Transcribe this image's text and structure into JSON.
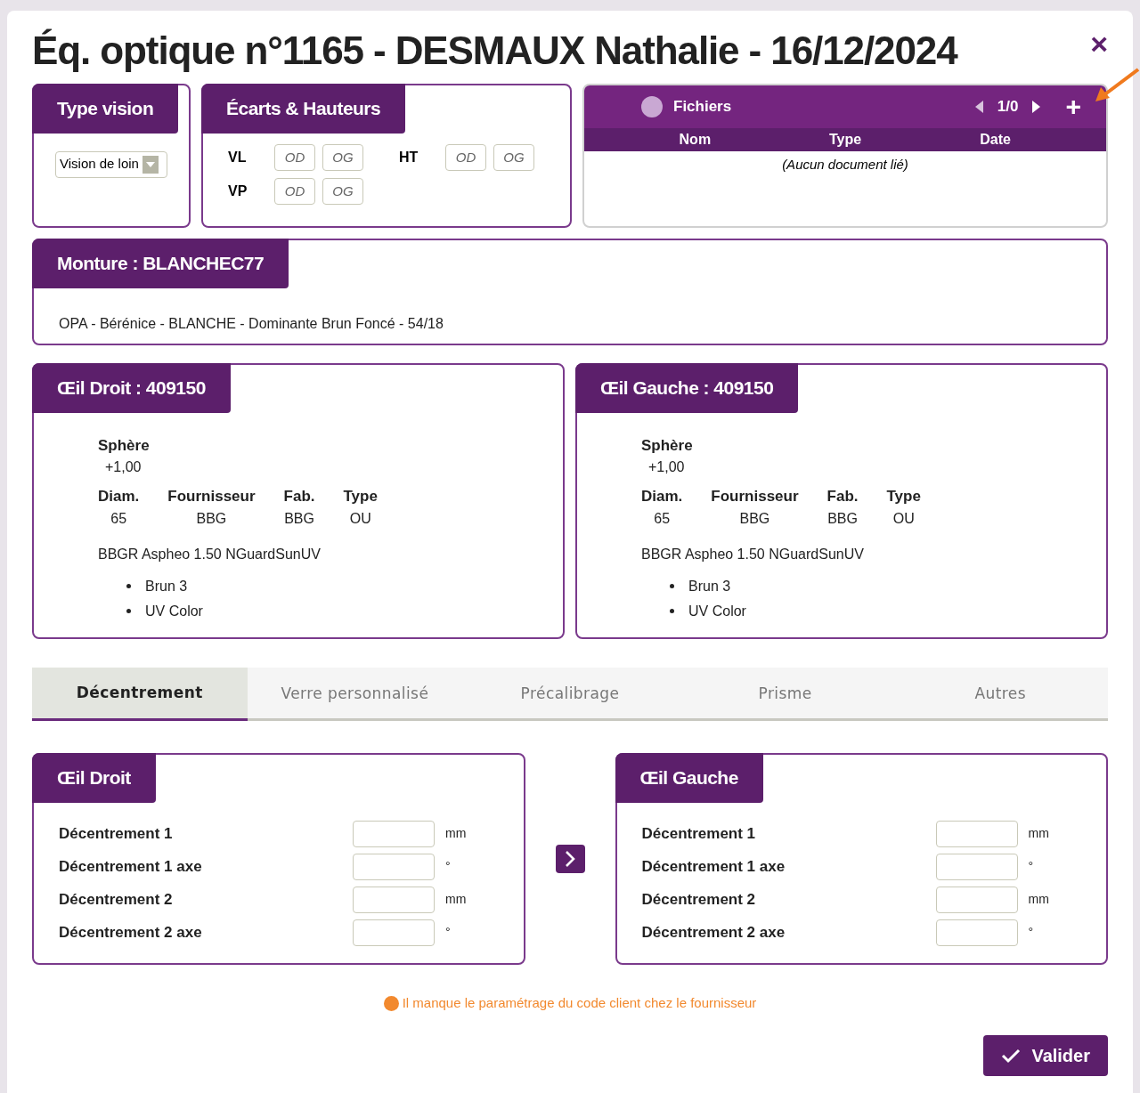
{
  "title": "Éq. optique n°1165 - DESMAUX Nathalie - 16/12/2024",
  "close": "×",
  "type_vision": {
    "title": "Type vision",
    "value": "Vision de loin"
  },
  "ecarts": {
    "title": "Écarts & Hauteurs",
    "rows": [
      {
        "label": "VL",
        "fields": [
          {
            "placeholder": "OD"
          },
          {
            "placeholder": "OG"
          }
        ]
      },
      {
        "label": "VP",
        "fields": [
          {
            "placeholder": "OD"
          },
          {
            "placeholder": "OG"
          }
        ]
      }
    ],
    "ht": {
      "label": "HT",
      "fields": [
        {
          "placeholder": "OD"
        },
        {
          "placeholder": "OG"
        }
      ]
    }
  },
  "fichiers": {
    "title": "Fichiers",
    "pager": "1/0",
    "add": "+",
    "columns": [
      "Nom",
      "Type",
      "Date"
    ],
    "empty": "(Aucun document lié)"
  },
  "monture": {
    "title": "Monture : BLANCHEC77",
    "description": "OPA - Bérénice - BLANCHE - Dominante Brun Foncé - 54/18"
  },
  "eyes": [
    {
      "title": "Œil Droit : 409150",
      "sphere_label": "Sphère",
      "sphere": "+1,00",
      "specs": [
        {
          "label": "Diam.",
          "value": "65"
        },
        {
          "label": "Fournisseur",
          "value": "BBG"
        },
        {
          "label": "Fab.",
          "value": "BBG"
        },
        {
          "label": "Type",
          "value": "OU"
        }
      ],
      "lens": "BBGR Aspheo 1.50 NGuardSunUV",
      "options": [
        "Brun 3",
        "UV Color"
      ]
    },
    {
      "title": "Œil Gauche : 409150",
      "sphere_label": "Sphère",
      "sphere": "+1,00",
      "specs": [
        {
          "label": "Diam.",
          "value": "65"
        },
        {
          "label": "Fournisseur",
          "value": "BBG"
        },
        {
          "label": "Fab.",
          "value": "BBG"
        },
        {
          "label": "Type",
          "value": "OU"
        }
      ],
      "lens": "BBGR Aspheo 1.50 NGuardSunUV",
      "options": [
        "Brun 3",
        "UV Color"
      ]
    }
  ],
  "tabs": [
    {
      "label": "Décentrement",
      "selected": true
    },
    {
      "label": "Verre personnalisé",
      "selected": false
    },
    {
      "label": "Précalibrage",
      "selected": false
    },
    {
      "label": "Prisme",
      "selected": false
    },
    {
      "label": "Autres",
      "selected": false
    }
  ],
  "decentrement": [
    {
      "title": "Œil Droit",
      "rows": [
        {
          "label": "Décentrement 1",
          "unit": "mm"
        },
        {
          "label": "Décentrement 1 axe",
          "unit": "°"
        },
        {
          "label": "Décentrement 2",
          "unit": "mm"
        },
        {
          "label": "Décentrement 2 axe",
          "unit": "°"
        }
      ]
    },
    {
      "title": "Œil Gauche",
      "rows": [
        {
          "label": "Décentrement 1",
          "unit": "mm"
        },
        {
          "label": "Décentrement 1 axe",
          "unit": "°"
        },
        {
          "label": "Décentrement 2",
          "unit": "mm"
        },
        {
          "label": "Décentrement 2 axe",
          "unit": "°"
        }
      ]
    }
  ],
  "warning": "Il manque le paramétrage du code client chez le fournisseur",
  "validate": "Valider"
}
